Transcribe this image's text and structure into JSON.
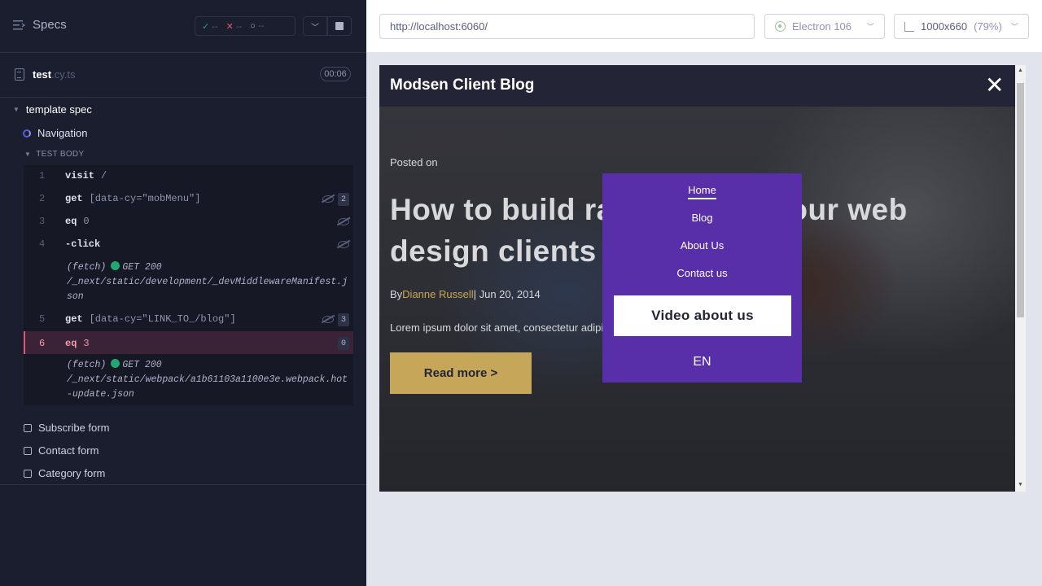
{
  "reporter": {
    "specs_label": "Specs",
    "stats": {
      "passed": "--",
      "failed": "--",
      "pending": "--"
    },
    "spec": {
      "name": "test",
      "ext": ".cy.ts",
      "duration": "00:06"
    },
    "suite_title": "template spec",
    "running_test": "Navigation",
    "test_body_label": "TEST BODY",
    "commands": [
      {
        "num": "1",
        "name": "visit",
        "message": "/"
      },
      {
        "num": "2",
        "name": "get",
        "message": "[data-cy=\"mobMenu\"]",
        "badge": "2"
      },
      {
        "num": "3",
        "name": "eq",
        "message": "0"
      },
      {
        "num": "4",
        "name": "-click",
        "message": ""
      },
      {
        "num": "5",
        "name": "get",
        "message": "[data-cy=\"LINK_TO_/blog\"]",
        "badge": "3"
      },
      {
        "num": "6",
        "name": "eq",
        "message": "3",
        "badge": "0"
      }
    ],
    "fetches": [
      {
        "type": "(fetch)",
        "status": "GET 200",
        "url": "/_next/static/development/_devMiddlewareManifest.json"
      },
      {
        "type": "(fetch)",
        "status": "GET 200",
        "url": "/_next/static/webpack/a1b61103a1100e3e.webpack.hot-update.json"
      }
    ],
    "other_tests": [
      "Subscribe form",
      "Contact form",
      "Category form"
    ]
  },
  "aut_bar": {
    "url": "http://localhost:6060/",
    "browser": "Electron 106",
    "viewport": "1000x660",
    "zoom": "(79%)"
  },
  "site": {
    "logo": "Modsen Client Blog",
    "close_glyph": "✕",
    "posted_on": "Posted on",
    "headline": "How to build rapport with your web design clients",
    "byline_prefix": "By",
    "author": "Dianne Russell",
    "date": "| Jun 20, 2014",
    "excerpt": "Lorem ipsum dolor sit amet, consectetur adipiscing elit",
    "read_more": "Read more >",
    "menu": {
      "links": [
        "Home",
        "Blog",
        "About Us",
        "Contact us"
      ],
      "video_button": "Video about us",
      "language": "EN"
    }
  },
  "colors": {
    "reporter_bg": "#1b1e2e",
    "menu_purple": "#592ea9",
    "accent_gold": "#c6a75a",
    "fail_red": "#e45770",
    "pass_green": "#1fa971"
  }
}
